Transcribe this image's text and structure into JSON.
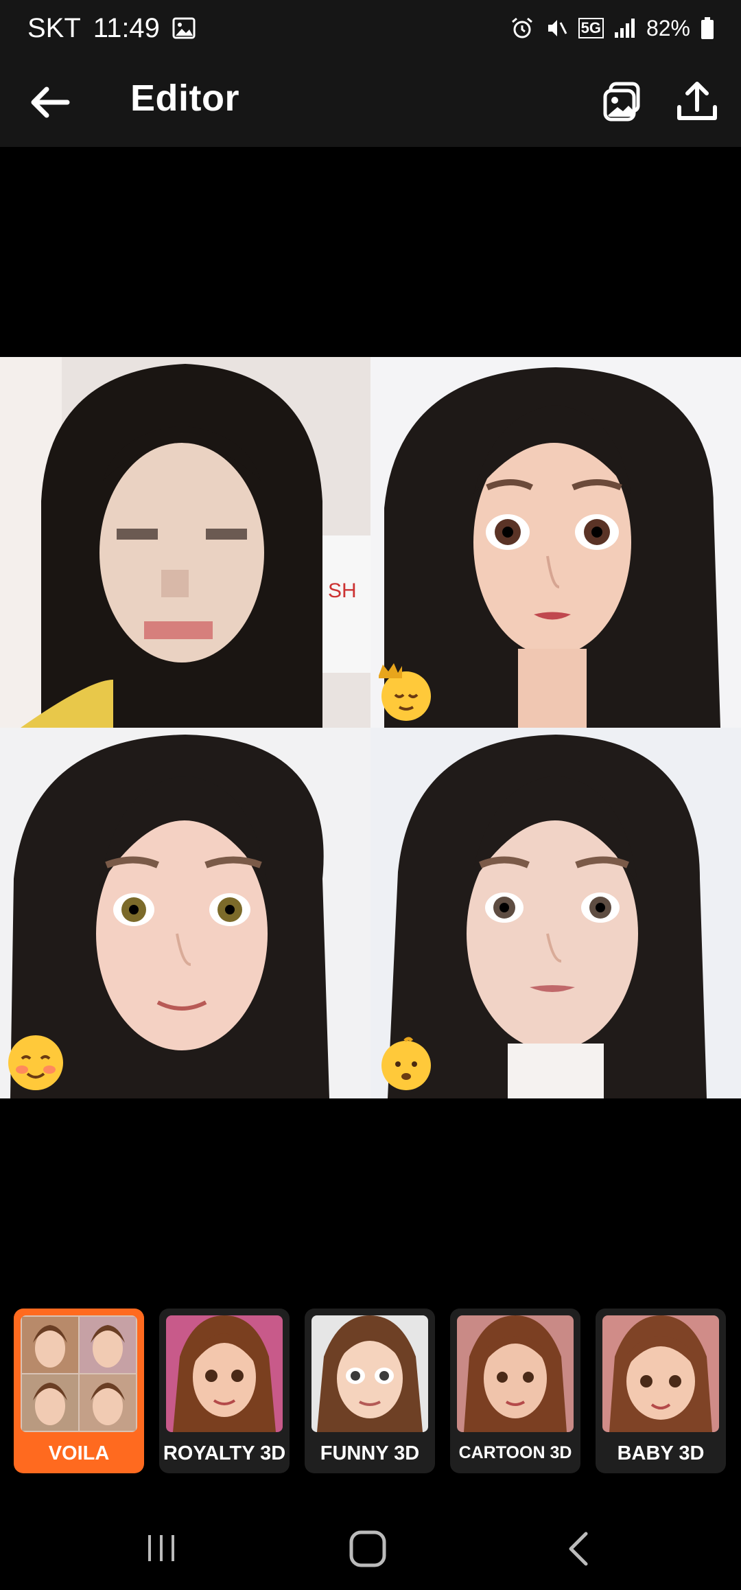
{
  "status_bar": {
    "carrier": "SKT",
    "time": "11:49",
    "network": "5G",
    "battery": "82%"
  },
  "app_bar": {
    "title": "Editor",
    "icons": [
      "back-arrow-icon",
      "gallery-icon",
      "share-upload-icon"
    ]
  },
  "results": [
    {
      "name": "original-photo",
      "badge": ""
    },
    {
      "name": "royalty-3d-result",
      "badge": "crown-smile-emoji"
    },
    {
      "name": "funny-3d-result",
      "badge": "smiling-blush-emoji"
    },
    {
      "name": "baby-3d-result",
      "badge": "baby-emoji"
    }
  ],
  "styles": [
    {
      "label": "VOILA",
      "selected": true
    },
    {
      "label": "ROYALTY 3D",
      "selected": false
    },
    {
      "label": "FUNNY 3D",
      "selected": false
    },
    {
      "label": "CARTOON 3D",
      "selected": false
    },
    {
      "label": "BABY 3D",
      "selected": false
    }
  ],
  "colors": {
    "accent": "#ff6a1f",
    "bar": "#161616",
    "card": "#1f1f1f"
  },
  "nav": [
    "recents-icon",
    "home-icon",
    "back-icon"
  ]
}
